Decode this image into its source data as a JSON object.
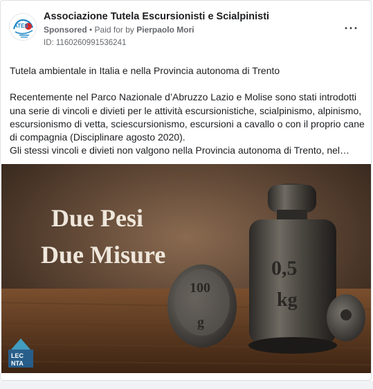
{
  "post": {
    "page_name": "Associazione Tutela Escursionisti e Scialpinisti",
    "sponsored": "Sponsored",
    "separator": " • ",
    "paid_for_prefix": "Paid for by ",
    "paid_for_name": "Pierpaolo Mori",
    "ad_id": "ID: 1160260991536241",
    "more_icon": "···",
    "text": {
      "line1": "Tutela ambientale in Italia e nella Provincia autonoma di Trento",
      "para2": "Recentemente nel Parco Nazionale d’Abruzzo Lazio e Molise sono stati introdotti una serie di vincoli e divieti per le attività escursionistiche, scialpinismo, alpinismo, escursionismo di vetta, sciescursionismo, escursioni a cavallo o con il proprio cane di compagnia (Disciplinare agosto 2020).",
      "para3": "Gli stessi vincoli e divieti non valgono nella Provincia autonoma di Trento, nel…"
    },
    "image": {
      "title_line1": "Due Pesi",
      "title_line2": "Due Misure",
      "weight_small": "100",
      "weight_small_unit": "g",
      "weight_large": "0,5",
      "weight_large_unit": "kg",
      "watermark": "LEC\nNTA"
    },
    "avatar_logo_text": "ATES"
  },
  "colors": {
    "text": "#1c1e21",
    "secondary": "#65676b",
    "border": "#dddfe2"
  }
}
